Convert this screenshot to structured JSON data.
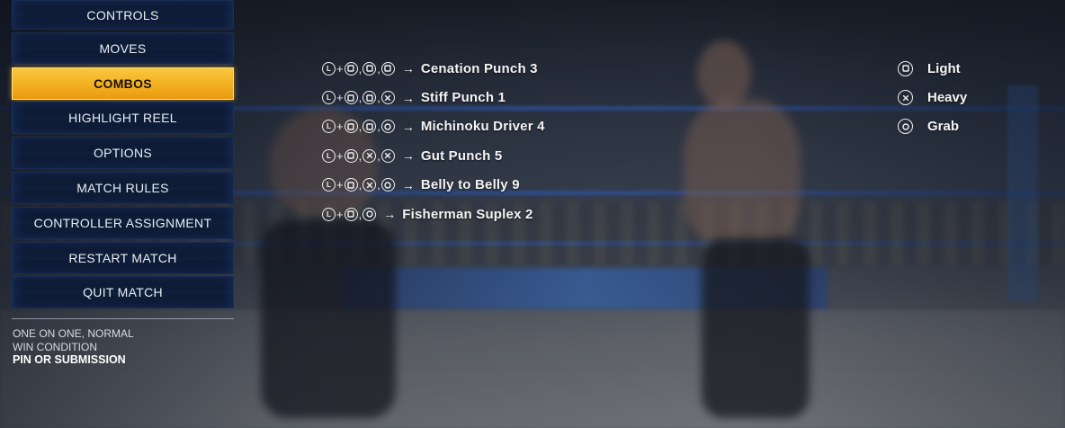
{
  "menu": {
    "items": [
      {
        "label": "CONTROLS",
        "active": false
      },
      {
        "label": "MOVES",
        "active": false
      },
      {
        "label": "COMBOS",
        "active": true
      },
      {
        "label": "HIGHLIGHT REEL",
        "active": false
      },
      {
        "label": "OPTIONS",
        "active": false
      },
      {
        "label": "MATCH RULES",
        "active": false
      },
      {
        "label": "CONTROLLER ASSIGNMENT",
        "active": false
      },
      {
        "label": "RESTART MATCH",
        "active": false
      },
      {
        "label": "QUIT MATCH",
        "active": false
      }
    ]
  },
  "match_info": {
    "type": "ONE ON ONE, NORMAL",
    "condition_label": "WIN CONDITION",
    "condition_value": "PIN OR SUBMISSION"
  },
  "combos": [
    {
      "inputs": [
        "L",
        "square",
        "square",
        "square"
      ],
      "name": "Cenation Punch 3"
    },
    {
      "inputs": [
        "L",
        "square",
        "square",
        "cross"
      ],
      "name": "Stiff Punch 1"
    },
    {
      "inputs": [
        "L",
        "square",
        "square",
        "circle"
      ],
      "name": "Michinoku Driver 4"
    },
    {
      "inputs": [
        "L",
        "square",
        "cross",
        "cross"
      ],
      "name": "Gut Punch 5"
    },
    {
      "inputs": [
        "L",
        "square",
        "cross",
        "circle"
      ],
      "name": "Belly to Belly 9"
    },
    {
      "inputs": [
        "L",
        "square",
        "circle"
      ],
      "name": "Fisherman Suplex 2"
    }
  ],
  "legend": [
    {
      "button": "square",
      "label": "Light"
    },
    {
      "button": "cross",
      "label": "Heavy"
    },
    {
      "button": "circle",
      "label": "Grab"
    }
  ],
  "symbols": {
    "plus": "+",
    "comma": ",",
    "arrow": "→",
    "stick": "L"
  },
  "colors": {
    "active_menu": "#f3b020",
    "menu_bg": "#0f1e3a"
  }
}
